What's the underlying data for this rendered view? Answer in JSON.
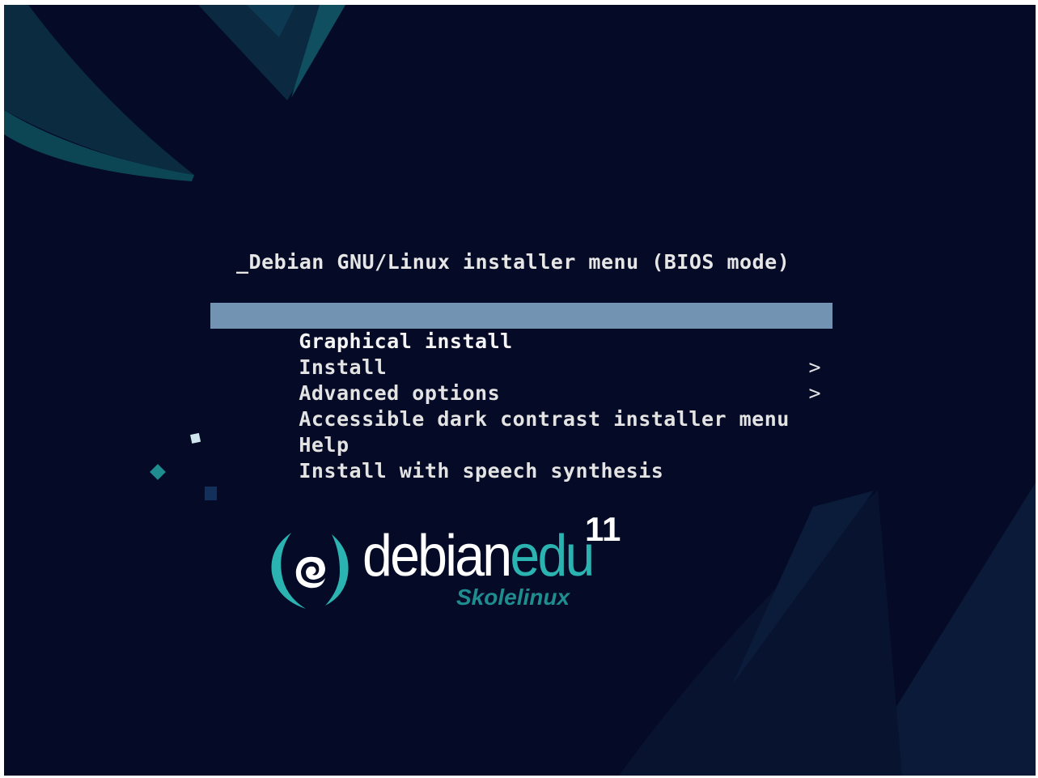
{
  "menu": {
    "title": "_Debian GNU/Linux installer menu (BIOS mode)",
    "items": [
      {
        "label": "Graphical install",
        "selected": true,
        "submenu": ""
      },
      {
        "label": "Install",
        "selected": false,
        "submenu": ""
      },
      {
        "label": "Advanced options",
        "selected": false,
        "submenu": ">"
      },
      {
        "label": "Accessible dark contrast installer menu",
        "selected": false,
        "submenu": ">"
      },
      {
        "label": "Help",
        "selected": false,
        "submenu": ""
      },
      {
        "label": "Install with speech synthesis",
        "selected": false,
        "submenu": ""
      }
    ]
  },
  "logo": {
    "word_part1": "debian",
    "word_part2": "edu",
    "version": "11",
    "subtitle": "Skolelinux"
  },
  "colors": {
    "background": "#050a26",
    "selection": "#7393b3",
    "accent": "#2bb3b1",
    "text": "#e3e3e3"
  }
}
